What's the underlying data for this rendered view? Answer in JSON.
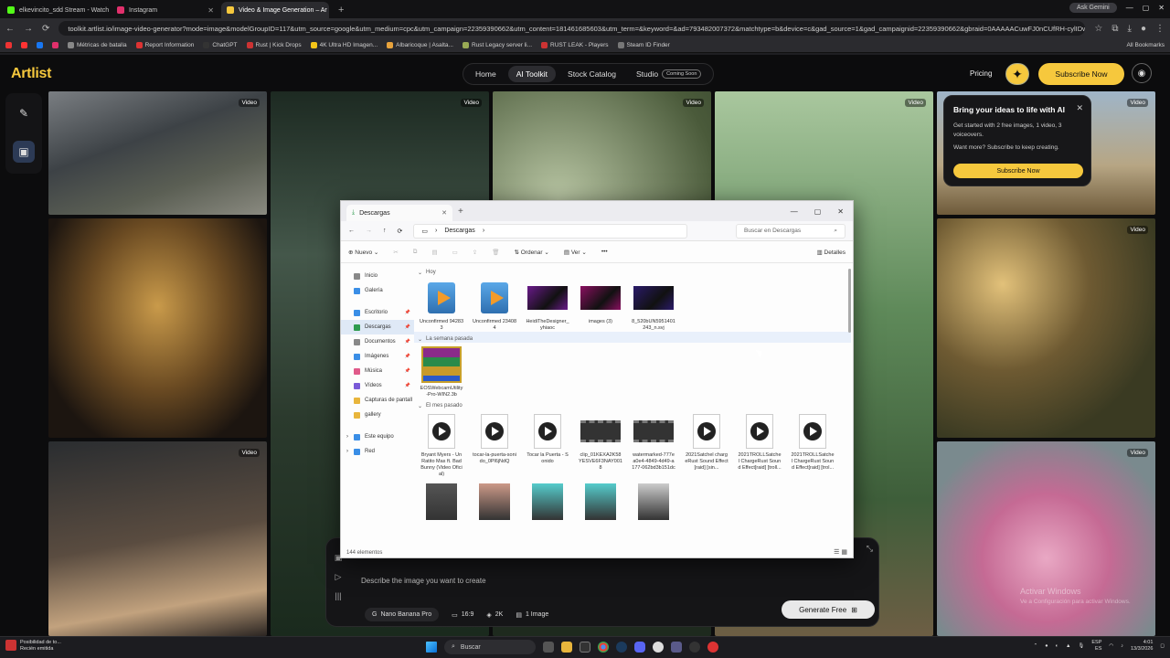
{
  "browser": {
    "tabs": [
      {
        "title": "elkevincito_sdd Stream - Watch",
        "color": "#53fc18"
      },
      {
        "title": "Instagram",
        "color": "#e1306c"
      },
      {
        "title": "Video & Image Generation – Ar",
        "color": "#f6c83d",
        "active": true
      }
    ],
    "new_tab": "+",
    "ask_gemini": "Ask Gemini",
    "url": "toolkit.artlist.io/image-video-generator?mode=image&modelGroupID=117&utm_source=google&utm_medium=cpc&utm_campaign=22359390662&utm_content=181461685603&utm_term=&keyword=&ad=793482007372&matchtype=b&device=c&gad_source=1&gad_campaignid=22359390662&gbraid=0AAAAACuwFJ0nCUfRH-cylIDwR...",
    "bookmarks": [
      {
        "label": "",
        "color": "#e33"
      },
      {
        "label": "",
        "color": "#f33"
      },
      {
        "label": "",
        "color": "#1877f2"
      },
      {
        "label": "",
        "color": "#e1306c"
      },
      {
        "label": "Métricas de batalla",
        "color": "#888"
      },
      {
        "label": "Report Information",
        "color": "#d33"
      },
      {
        "label": "ChatGPT",
        "color": "#333"
      },
      {
        "label": "Rust | Kick Drops",
        "color": "#c33"
      },
      {
        "label": "4K Ultra HD Imagen...",
        "color": "#f5c518"
      },
      {
        "label": "Albaricoque | Asalta...",
        "color": "#e8a33c"
      },
      {
        "label": "Rust Legacy server li...",
        "color": "#9a5"
      },
      {
        "label": "RUST LEAK - Players",
        "color": "#c33"
      },
      {
        "label": "Steam ID Finder",
        "color": "#777"
      }
    ],
    "all_bookmarks": "All Bookmarks"
  },
  "site": {
    "logo": "Artlist",
    "nav": [
      {
        "label": "Home"
      },
      {
        "label": "AI Toolkit",
        "active": true
      },
      {
        "label": "Stock Catalog"
      },
      {
        "label": "Studio",
        "badge": "Coming Soon"
      }
    ],
    "pricing": "Pricing",
    "subscribe": "Subscribe Now",
    "video_badge": "Video",
    "promo": {
      "title": "Bring your ideas to life with AI",
      "line1": "Get started with 2 free images, 1 video, 3 voiceovers.",
      "line2": "Want more? Subscribe to keep creating.",
      "button": "Subscribe Now"
    },
    "prompt": {
      "placeholder": "Describe the image you want to create",
      "model": "Nano Banana Pro",
      "ratio": "16:9",
      "quality": "2K",
      "count": "1 Image",
      "generate": "Generate Free"
    },
    "watermark": {
      "title": "Activar Windows",
      "sub": "Ve a Configuración para activar Windows."
    }
  },
  "explorer": {
    "tab_title": "Descargas",
    "path": "Descargas",
    "search_placeholder": "Buscar en Descargas",
    "toolbar": {
      "new": "Nuevo",
      "sort": "Ordenar",
      "view": "Ver",
      "details": "Detalles"
    },
    "sidebar": [
      {
        "label": "Inicio",
        "color": "#888"
      },
      {
        "label": "Galería",
        "color": "#3a8ee6"
      },
      {
        "label": "Escritorio",
        "color": "#3a8ee6",
        "pin": true
      },
      {
        "label": "Descargas",
        "color": "#2e9b4e",
        "pin": true,
        "selected": true
      },
      {
        "label": "Documentos",
        "color": "#888",
        "pin": true
      },
      {
        "label": "Imágenes",
        "color": "#3a8ee6",
        "pin": true
      },
      {
        "label": "Música",
        "color": "#e05a8a",
        "pin": true
      },
      {
        "label": "Vídeos",
        "color": "#7a5ad8",
        "pin": true
      },
      {
        "label": "Capturas de pantall",
        "color": "#e8b53c"
      },
      {
        "label": "gallery",
        "color": "#e8b53c"
      },
      {
        "label": "Este equipo",
        "color": "#3a8ee6"
      },
      {
        "label": "Red",
        "color": "#3a8ee6"
      }
    ],
    "groups": [
      {
        "label": "Hoy",
        "files": [
          {
            "name": "Unconfirmed 942833",
            "kind": "vlc"
          },
          {
            "name": "Unconfirmed 234084",
            "kind": "vlc"
          },
          {
            "name": "HeidiTheDesigner_yhiaoc",
            "kind": "img",
            "color": "#6a1a8a"
          },
          {
            "name": "images (3)",
            "kind": "img",
            "color": "#8a1060"
          },
          {
            "name": "8_520bUN5951401243_n.svj",
            "kind": "img",
            "color": "#2a1a6a"
          }
        ]
      },
      {
        "label": "La semana pasada",
        "files": [
          {
            "name": "EOSWebcamUtility-Pro-WIN2.3b",
            "kind": "rar"
          }
        ]
      },
      {
        "label": "El mes pasado",
        "files": [
          {
            "name": "Bryant Myers - Un Ratito Mas ft. Bad Bunny (Video Oficial)",
            "kind": "media"
          },
          {
            "name": "tocar-la-puerta-sonido_0Pl6jNdQ",
            "kind": "media"
          },
          {
            "name": "Tocar la Puerta - Sonido",
            "kind": "media"
          },
          {
            "name": "clip_01KEXA2K58YESVE6F3NAY0018",
            "kind": "film"
          },
          {
            "name": "watermarked-777ea0e4-4849-4d49-a177-062bd3b151dc",
            "kind": "film"
          },
          {
            "name": "2021Satchel chargeRust Sound Effect[raid] [sin...",
            "kind": "media"
          },
          {
            "name": "2021TROLLSatchel ChargeRust Sound Effect[raid] [troll...",
            "kind": "media"
          },
          {
            "name": "2021TROLLSatchel ChargeRust Sound Effect[raid] [trol...",
            "kind": "media"
          }
        ]
      }
    ],
    "extra_row": [
      {
        "color": "#555"
      },
      {
        "color": "#c98"
      },
      {
        "color": "#5cc"
      },
      {
        "color": "#5cc"
      },
      {
        "color": "#ccc"
      }
    ],
    "status": "144 elementos"
  },
  "taskbar": {
    "notification_title": "Posibilidad de to...",
    "notification_sub": "Recién emitida",
    "search": "Buscar",
    "lang1": "ESP",
    "lang2": "ES",
    "time": "4:01",
    "date": "13/3/2026"
  }
}
